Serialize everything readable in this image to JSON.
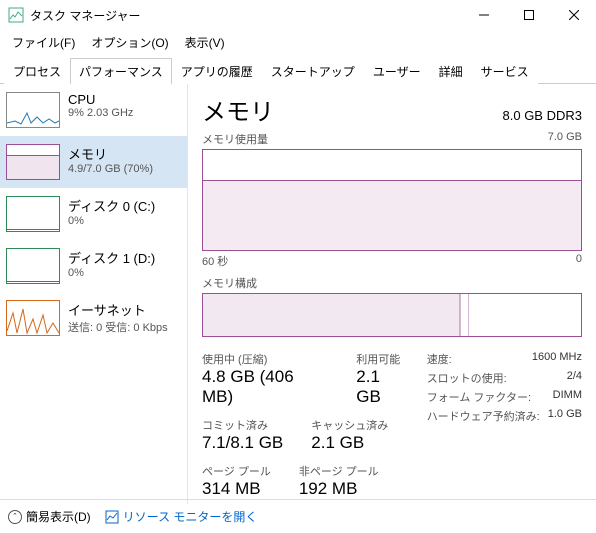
{
  "window": {
    "title": "タスク マネージャー"
  },
  "menu": {
    "file": "ファイル(F)",
    "options": "オプション(O)",
    "view": "表示(V)"
  },
  "tabs": [
    "プロセス",
    "パフォーマンス",
    "アプリの履歴",
    "スタートアップ",
    "ユーザー",
    "詳細",
    "サービス"
  ],
  "active_tab": 1,
  "sidebar": {
    "items": [
      {
        "title": "CPU",
        "sub": "9%  2.03 GHz",
        "color": "#1f77b4"
      },
      {
        "title": "メモリ",
        "sub": "4.9/7.0 GB (70%)",
        "color": "#9b4f96",
        "selected": true
      },
      {
        "title": "ディスク 0 (C:)",
        "sub": "0%",
        "color": "#2e8b57"
      },
      {
        "title": "ディスク 1 (D:)",
        "sub": "0%",
        "color": "#2e8b57"
      },
      {
        "title": "イーサネット",
        "sub": "送信: 0  受信: 0 Kbps",
        "color": "#d2691e"
      }
    ]
  },
  "main": {
    "title": "メモリ",
    "spec": "8.0 GB DDR3",
    "usage_label": "メモリ使用量",
    "usage_max": "7.0 GB",
    "time_left": "60 秒",
    "time_right": "0",
    "comp_label": "メモリ構成",
    "stats": {
      "in_use_label": "使用中 (圧縮)",
      "in_use_value": "4.8 GB (406 MB)",
      "available_label": "利用可能",
      "available_value": "2.1 GB",
      "committed_label": "コミット済み",
      "committed_value": "7.1/8.1 GB",
      "cached_label": "キャッシュ済み",
      "cached_value": "2.1 GB",
      "paged_label": "ページ プール",
      "paged_value": "314 MB",
      "nonpaged_label": "非ページ プール",
      "nonpaged_value": "192 MB"
    },
    "right": {
      "speed_k": "速度:",
      "speed_v": "1600 MHz",
      "slots_k": "スロットの使用:",
      "slots_v": "2/4",
      "form_k": "フォーム ファクター:",
      "form_v": "DIMM",
      "hw_k": "ハードウェア予約済み:",
      "hw_v": "1.0 GB"
    }
  },
  "footer": {
    "fewer": "簡易表示(D)",
    "resmon": "リソース モニターを開く"
  },
  "chart_data": {
    "type": "area",
    "title": "メモリ使用量",
    "ylabel": "GB",
    "ylim": [
      0,
      7.0
    ],
    "xlabel": "秒",
    "xlim": [
      60,
      0
    ],
    "series": [
      {
        "name": "使用中",
        "values": [
          4.9,
          4.9,
          4.9,
          4.9,
          4.9,
          4.9,
          4.9,
          4.9,
          4.9,
          4.9,
          4.9,
          4.9,
          4.9,
          4.9,
          4.9,
          4.9,
          4.9,
          4.9,
          4.9,
          4.9
        ]
      }
    ],
    "composition": {
      "in_use_pct": 68,
      "modified_pct": 2,
      "standby_pct": 30,
      "free_pct": 0
    }
  }
}
